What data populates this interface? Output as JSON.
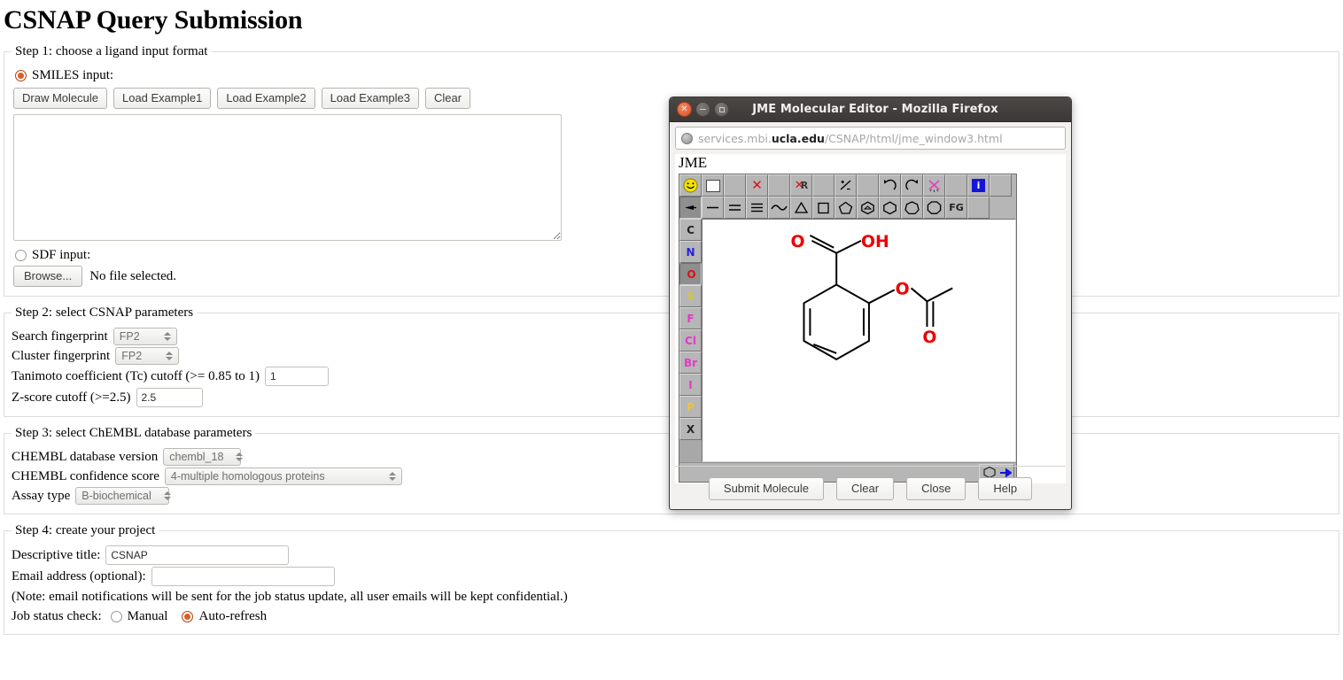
{
  "page": {
    "title": "CSNAP Query Submission"
  },
  "step1": {
    "legend": "Step 1: choose a ligand input format",
    "smiles_label": "SMILES input:",
    "smiles_selected": true,
    "buttons": [
      "Draw Molecule",
      "Load Example1",
      "Load Example2",
      "Load Example3",
      "Clear"
    ],
    "textarea_value": "",
    "sdf_label": "SDF input:",
    "sdf_selected": false,
    "browse_label": "Browse...",
    "file_status": "No file selected."
  },
  "step2": {
    "legend": "Step 2: select CSNAP parameters",
    "search_fp_label": "Search fingerprint",
    "search_fp_value": "FP2",
    "cluster_fp_label": "Cluster fingerprint",
    "cluster_fp_value": "FP2",
    "tanimoto_label": "Tanimoto coefficient (Tc) cutoff (>= 0.85 to 1)",
    "tanimoto_value": "1",
    "zscore_label": "Z-score cutoff (>=2.5)",
    "zscore_value": "2.5"
  },
  "step3": {
    "legend": "Step 3: select ChEMBL database parameters",
    "db_version_label": "CHEMBL database version",
    "db_version_value": "chembl_18",
    "confidence_label": "CHEMBL confidence score",
    "confidence_value": "4-multiple homologous proteins",
    "assay_label": "Assay type",
    "assay_value": "B-biochemical"
  },
  "step4": {
    "legend": "Step 4: create your project",
    "title_label": "Descriptive title:",
    "title_value": "CSNAP",
    "email_label": "Email address (optional):",
    "email_value": "",
    "note": "(Note: email notifications will be sent for the job status update, all user emails will be kept confidential.)",
    "job_status_label": "Job status check:",
    "manual_label": "Manual",
    "manual_selected": false,
    "autorefresh_label": "Auto-refresh",
    "autorefresh_selected": true
  },
  "jme_window": {
    "title": "JME Molecular Editor - Mozilla Firefox",
    "url_prefix": "services.mbi.",
    "url_domain": "ucla.edu",
    "url_path": "/CSNAP/html/jme_window3.html",
    "heading": "JME",
    "toolbar_row1": [
      {
        "name": "smiley-icon",
        "glyph": "☺"
      },
      {
        "name": "new-molecule-icon",
        "glyph": ""
      },
      {
        "name": "blank-1",
        "glyph": ""
      },
      {
        "name": "delete-icon",
        "glyph": "×"
      },
      {
        "name": "blank-2",
        "glyph": ""
      },
      {
        "name": "delete-group-icon",
        "glyph": "R"
      },
      {
        "name": "blank-3",
        "glyph": ""
      },
      {
        "name": "charge-icon",
        "glyph": "+/-"
      },
      {
        "name": "blank-4",
        "glyph": ""
      },
      {
        "name": "undo-icon",
        "glyph": "↺"
      },
      {
        "name": "redo-icon",
        "glyph": "↻"
      },
      {
        "name": "clean-icon",
        "glyph": "✳"
      },
      {
        "name": "blank-5",
        "glyph": ""
      },
      {
        "name": "info-icon",
        "glyph": "i"
      },
      {
        "name": "blank-6",
        "glyph": ""
      }
    ],
    "toolbar_row2": [
      {
        "name": "stereo-bond-icon"
      },
      {
        "name": "single-bond-icon"
      },
      {
        "name": "double-bond-icon"
      },
      {
        "name": "triple-bond-icon"
      },
      {
        "name": "chain-icon"
      },
      {
        "name": "triangle-ring-icon"
      },
      {
        "name": "square-ring-icon"
      },
      {
        "name": "pentagon-ring-icon"
      },
      {
        "name": "furan-ring-icon"
      },
      {
        "name": "hexagon-ring-icon"
      },
      {
        "name": "heptagon-ring-icon"
      },
      {
        "name": "octagon-ring-icon"
      },
      {
        "name": "functional-group-icon",
        "glyph": "FG"
      },
      {
        "name": "blank-7"
      },
      {
        "name": "blank-8"
      }
    ],
    "atoms": [
      {
        "label": "C",
        "color": "#222222",
        "selected": false
      },
      {
        "label": "N",
        "color": "#2222dd",
        "selected": false
      },
      {
        "label": "O",
        "color": "#dd1111",
        "selected": true
      },
      {
        "label": "S",
        "color": "#b3b300",
        "selected": false
      },
      {
        "label": "F",
        "color": "#ee33cc",
        "selected": false
      },
      {
        "label": "Cl",
        "color": "#ee33cc",
        "selected": false
      },
      {
        "label": "Br",
        "color": "#ee33cc",
        "selected": false
      },
      {
        "label": "I",
        "color": "#ee33cc",
        "selected": false
      },
      {
        "label": "P",
        "color": "#e8b000",
        "selected": false
      },
      {
        "label": "X",
        "color": "#222222",
        "selected": false
      }
    ],
    "molecule": {
      "name": "aspirin",
      "labels": [
        "O",
        "OH",
        "O",
        "O"
      ],
      "oxygen_color": "#ee0000"
    },
    "smiles_export_icon": "hexagon-arrow-icon",
    "footer_buttons": [
      "Submit Molecule",
      "Clear",
      "Close",
      "Help"
    ]
  }
}
